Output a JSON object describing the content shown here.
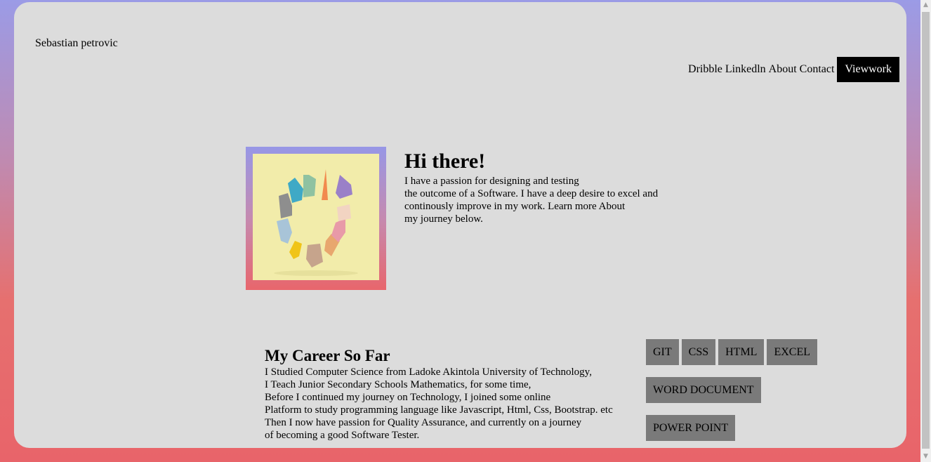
{
  "header": {
    "brand": "Sebastian petrovic",
    "nav": [
      "Dribble",
      "Linkedln",
      "About",
      "Contact"
    ],
    "cta": "Viewwork"
  },
  "hero": {
    "title": "Hi there!",
    "lines": [
      "I have a passion for designing and testing",
      "the outcome of a Software. I have a deep desire to excel and",
      "continously improve in my work. Learn more About",
      "my journey below."
    ]
  },
  "career": {
    "title": "My Career So Far",
    "lines": [
      "I Studied Computer Science from Ladoke Akintola University of Technology,",
      "I Teach Junior Secondary Schools Mathematics, for some time,",
      "Before I continued my journey on Technology, I joined some online",
      "Platform to study programming language like Javascript, Html, Css, Bootstrap. etc",
      "Then I now have passion for Quality Assurance, and currently on a journey",
      "of becoming a good Software Tester."
    ]
  },
  "skills": [
    "GIT",
    "CSS",
    "HTML",
    "EXCEL",
    "WORD DOCUMENT",
    "POWER POINT"
  ],
  "colors": {
    "gradient_top": "#9b9be6",
    "gradient_bottom": "#e8646a",
    "card_bg": "#dcdcdc",
    "skill_bg": "#7a7a7a",
    "button_bg": "#000000"
  }
}
